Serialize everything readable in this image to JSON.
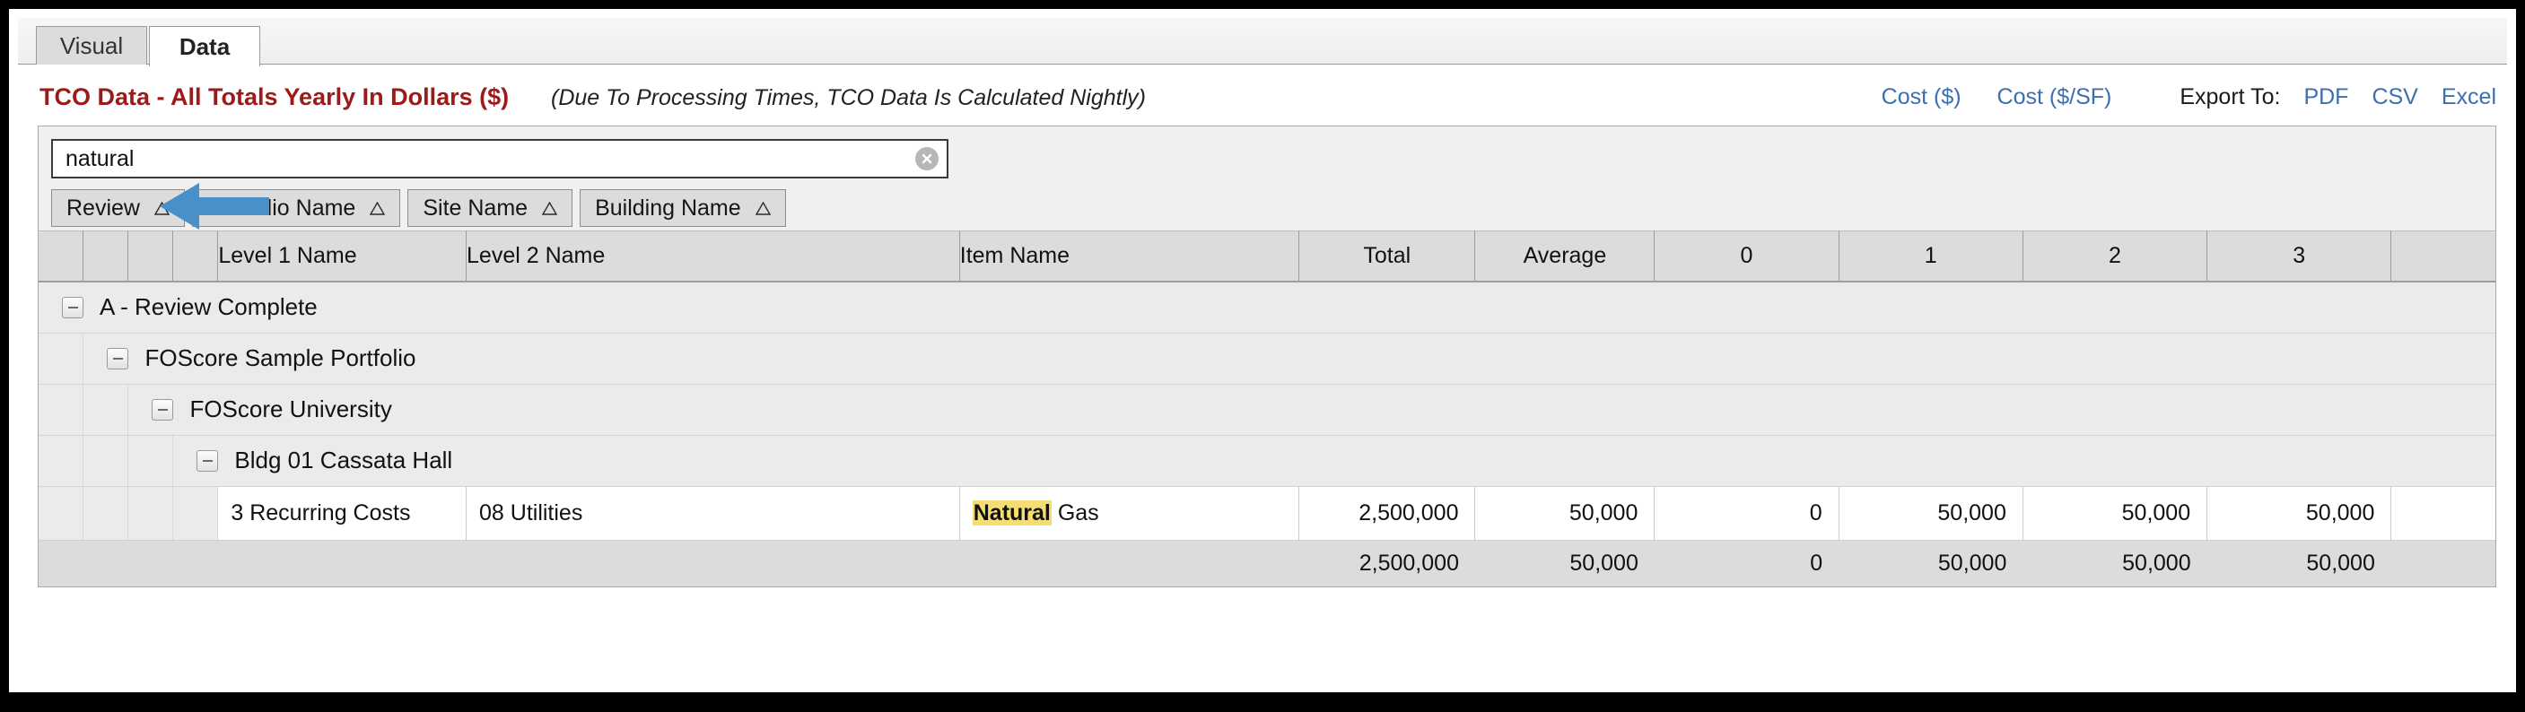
{
  "tabs": [
    {
      "label": "Visual",
      "active": false
    },
    {
      "label": "Data",
      "active": true
    }
  ],
  "header": {
    "title": "TCO Data - All Totals Yearly In Dollars ($)",
    "subtitle": "(Due To Processing Times, TCO Data Is Calculated Nightly)",
    "cost_dollar_link": "Cost ($)",
    "cost_per_sf_link": "Cost ($/SF)",
    "export_label": "Export To:",
    "export_pdf": "PDF",
    "export_csv": "CSV",
    "export_excel": "Excel",
    "link_color": "#3c6fad",
    "title_color": "#9b1b1b"
  },
  "search": {
    "value": "natural",
    "placeholder": "",
    "clear_icon": "clear-circle-icon"
  },
  "annotation": {
    "arrow": "left-pointing-arrow",
    "color": "#4a90c8"
  },
  "sort_chips": [
    {
      "label": "Review",
      "sort": "ascending"
    },
    {
      "label": "Portfolio Name",
      "sort": "ascending"
    },
    {
      "label": "Site Name",
      "sort": "ascending"
    },
    {
      "label": "Building Name",
      "sort": "ascending"
    }
  ],
  "grid": {
    "columns": [
      {
        "label": "",
        "type": "tree"
      },
      {
        "label": "",
        "type": "tree"
      },
      {
        "label": "",
        "type": "tree"
      },
      {
        "label": "",
        "type": "tree"
      },
      {
        "label": "Level 1 Name",
        "type": "text"
      },
      {
        "label": "Level 2 Name",
        "type": "text"
      },
      {
        "label": "Item Name",
        "type": "text"
      },
      {
        "label": "Total",
        "type": "number"
      },
      {
        "label": "Average",
        "type": "number"
      },
      {
        "label": "0",
        "type": "number"
      },
      {
        "label": "1",
        "type": "number"
      },
      {
        "label": "2",
        "type": "number"
      },
      {
        "label": "3",
        "type": "number"
      },
      {
        "label": "",
        "type": "number"
      }
    ],
    "groups": [
      {
        "label": "A - Review Complete",
        "level": 0,
        "expanded": true
      },
      {
        "label": "FOScore Sample Portfolio",
        "level": 1,
        "expanded": true
      },
      {
        "label": "FOScore University",
        "level": 2,
        "expanded": true
      },
      {
        "label": "Bldg 01 Cassata Hall",
        "level": 3,
        "expanded": true
      }
    ],
    "rows": [
      {
        "level1": "3 Recurring Costs",
        "level2": "08 Utilities",
        "item_highlight": "Natural",
        "item_rest": " Gas",
        "total": "2,500,000",
        "average": "50,000",
        "y0": "0",
        "y1": "50,000",
        "y2": "50,000",
        "y3": "50,000",
        "y4": ""
      }
    ],
    "totals": {
      "total": "2,500,000",
      "average": "50,000",
      "y0": "0",
      "y1": "50,000",
      "y2": "50,000",
      "y3": "50,000",
      "y4": ""
    }
  }
}
